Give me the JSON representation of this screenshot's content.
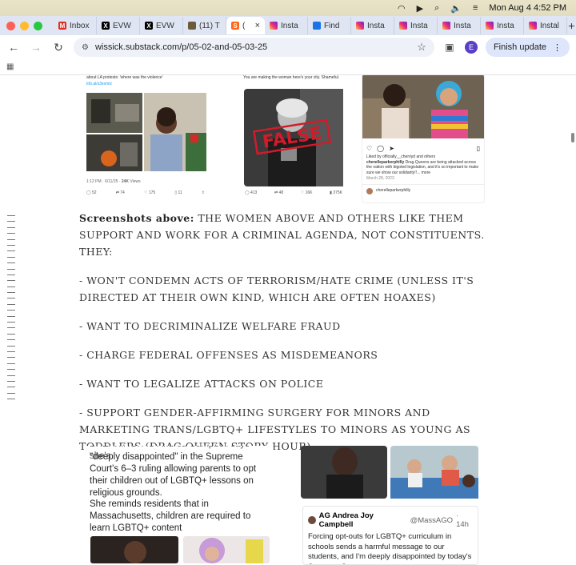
{
  "menubar": {
    "datetime": "Mon Aug 4  4:52 PM"
  },
  "tabs": [
    {
      "label": "Inbox",
      "icon": "gmail-icon",
      "color": "#d93025",
      "glyph": "M"
    },
    {
      "label": "EVW",
      "icon": "x-icon",
      "color": "#000000",
      "glyph": "X"
    },
    {
      "label": "EVW",
      "icon": "x-icon",
      "color": "#000000",
      "glyph": "X"
    },
    {
      "label": "(11) T",
      "icon": "tab-favicon",
      "color": "#6b5b3a",
      "glyph": ""
    },
    {
      "label": "(",
      "icon": "substack-icon",
      "color": "#ff6719",
      "glyph": "S",
      "active": true
    },
    {
      "label": "Insta",
      "icon": "instagram-icon",
      "color": "#d6249f",
      "glyph": ""
    },
    {
      "label": "Find",
      "icon": "globe-icon",
      "color": "#1a73e8",
      "glyph": ""
    },
    {
      "label": "Insta",
      "icon": "instagram-icon",
      "color": "#d6249f",
      "glyph": ""
    },
    {
      "label": "Insta",
      "icon": "instagram-icon",
      "color": "#d6249f",
      "glyph": ""
    },
    {
      "label": "Insta",
      "icon": "instagram-icon",
      "color": "#d6249f",
      "glyph": ""
    },
    {
      "label": "Insta",
      "icon": "instagram-icon",
      "color": "#d6249f",
      "glyph": ""
    },
    {
      "label": "Instal",
      "icon": "instagram-icon",
      "color": "#d6249f",
      "glyph": ""
    }
  ],
  "toolbar": {
    "url": "wissick.substack.com/p/05-02-and-05-03-25",
    "avatar_letter": "E",
    "finish_update": "Finish update"
  },
  "screenshots": {
    "tweet": {
      "top_text": "about LA protests: 'where was the violence'",
      "link": "trib.al/s3exmlz",
      "time": "1:12 PM · 6/11/25 ·",
      "views": "24K",
      "views_label": "Views",
      "replies": "52",
      "retweets": "74",
      "likes": "175",
      "bookmarks": "11"
    },
    "false_post": {
      "top_text": "You are making the woman here's your city. Shameful.",
      "stamp": "FALSE",
      "stats": [
        "413",
        "48",
        "16K",
        "375K"
      ]
    },
    "insta_post": {
      "liked_by": "Liked by officially__cherriyd and others",
      "caption_user": "cherelleparkerphilly",
      "caption": "Drag Queens are being attacked across the nation with bigoted legislation, and it's so important to make sure we show our solidarity!!... more",
      "date": "March 28, 2023",
      "account": "cherelleparkerphilly"
    }
  },
  "article": {
    "intro_bold": "Screenshots above:",
    "intro_text": "THE WOMEN ABOVE AND OTHERS LIKE THEM SUPPORT AND WORK FOR A CRIMINAL AGENDA, NOT CONSTITUENTS. THEY:",
    "items": [
      "- WON'T CONDEMN ACTS OF TERRORISM/HATE CRIME (UNLESS IT'S DIRECTED AT THEIR OWN KIND, WHICH ARE OFTEN HOAXES)",
      "- WANT TO DECRIMINALIZE WELFARE FRAUD",
      "- CHARGE FEDERAL OFFENSES AS MISDEMEANORS",
      "- WANT TO LEGALIZE ATTACKS ON POLICE",
      "- SUPPORT GENDER-AFFIRMING SURGERY FOR MINORS AND MARKETING TRANS/LGBTQ+ LIFESTYLES TO MINORS AS YOUNG AS TODDLERS (DRAG QUEEN STORY HOUR)"
    ]
  },
  "lower_left": {
    "cut_line": "BREAKING: AG Andrea Campbell says she's",
    "para1": "\"deeply disappointed\" in the Supreme Court's 6–3 ruling allowing parents to opt their children out of LGBTQ+ lessons on religious grounds.",
    "para2": "She reminds residents that in Massachusetts, children are required to learn LGBTQ+ content"
  },
  "lower_right": {
    "name": "AG Andrea Joy Campbell",
    "handle": "@MassAGO",
    "time": "· 14h",
    "text": "Forcing opt-outs for LGBTQ+ curriculum in schools sends a harmful message to our students, and I'm deeply disappointed by today's Supreme Court"
  }
}
